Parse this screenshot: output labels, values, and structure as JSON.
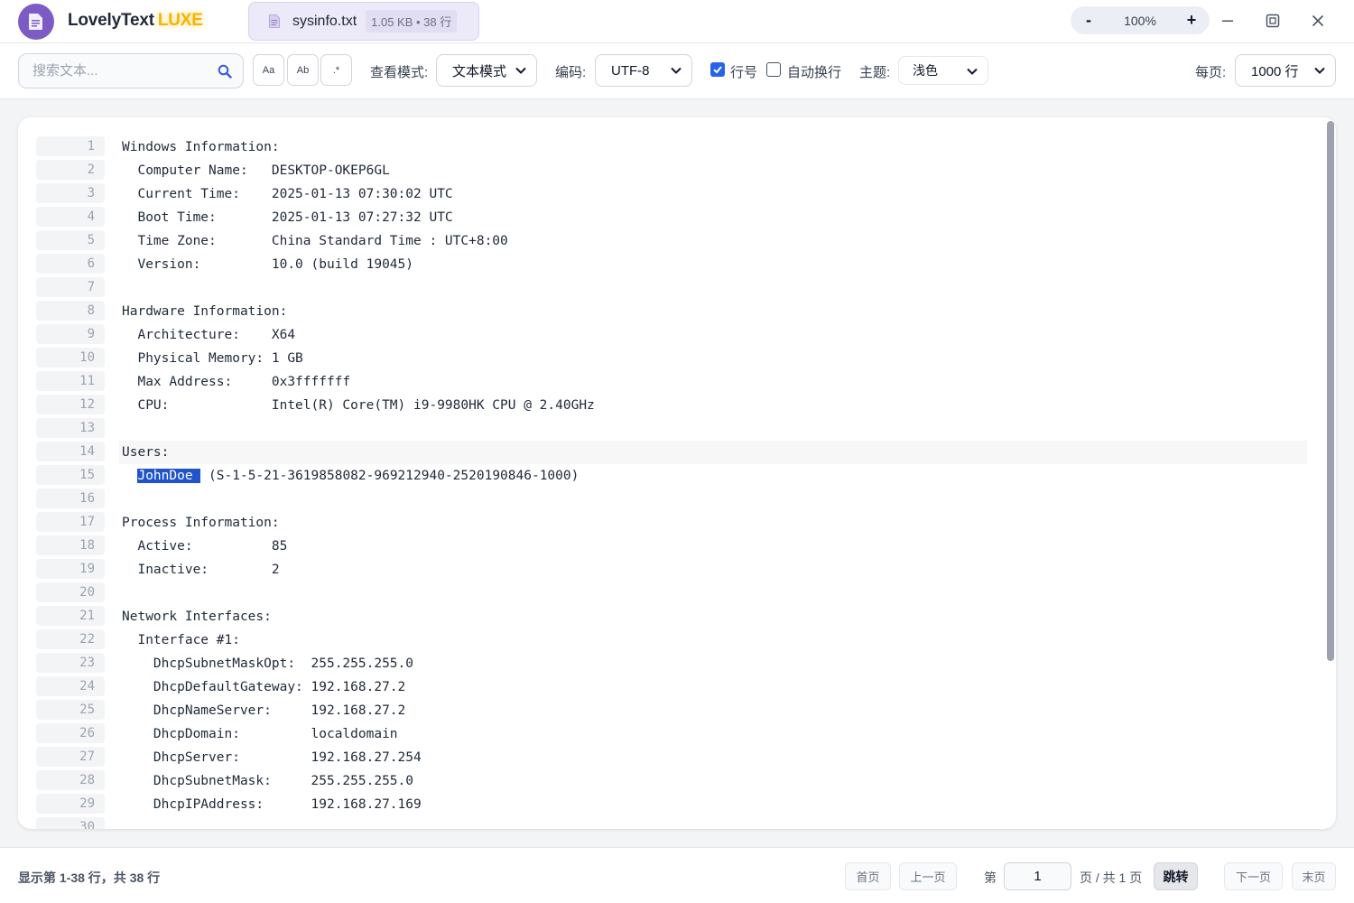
{
  "titlebar": {
    "app_name": "LovelyText",
    "app_badge": "LUXE",
    "file_name": "sysinfo.txt",
    "file_meta": "1.05 KB • 38 行",
    "zoom_out": "-",
    "zoom_level": "100%",
    "zoom_in": "+"
  },
  "toolbar": {
    "search_placeholder": "搜索文本...",
    "match_case": "Aa",
    "whole_word": "Ab",
    "regex": ".*",
    "view_mode_label": "查看模式:",
    "view_mode_value": "文本模式",
    "encoding_label": "编码:",
    "encoding_value": "UTF-8",
    "line_numbers_label": "行号",
    "line_numbers_checked": true,
    "word_wrap_label": "自动换行",
    "word_wrap_checked": false,
    "theme_label": "主题:",
    "theme_value": "浅色",
    "per_page_label": "每页:",
    "per_page_value": "1000 行"
  },
  "document": {
    "lines": [
      "Windows Information:",
      "  Computer Name:   DESKTOP-OKEP6GL",
      "  Current Time:    2025-01-13 07:30:02 UTC",
      "  Boot Time:       2025-01-13 07:27:32 UTC",
      "  Time Zone:       China Standard Time : UTC+8:00",
      "  Version:         10.0 (build 19045)",
      "",
      "Hardware Information:",
      "  Architecture:    X64",
      "  Physical Memory: 1 GB",
      "  Max Address:     0x3fffffff",
      "  CPU:             Intel(R) Core(TM) i9-9980HK CPU @ 2.40GHz",
      "",
      "Users:",
      "  JohnDoe  (S-1-5-21-3619858082-969212940-2520190846-1000)",
      "",
      "Process Information:",
      "  Active:          85",
      "  Inactive:        2",
      "",
      "Network Interfaces:",
      "  Interface #1:",
      "    DhcpSubnetMaskOpt:  255.255.255.0",
      "    DhcpDefaultGateway: 192.168.27.2",
      "    DhcpNameServer:     192.168.27.2",
      "    DhcpDomain:         localdomain",
      "    DhcpServer:         192.168.27.254",
      "    DhcpSubnetMask:     255.255.255.0",
      "    DhcpIPAddress:      192.168.27.169",
      ""
    ],
    "selection_text": "JohnDoe ",
    "selection_line": 15,
    "current_line": 14
  },
  "footer": {
    "status": "显示第 1-38 行，共 38 行",
    "first_page": "首页",
    "prev_page": "上一页",
    "page_prefix": "第",
    "page_value": "1",
    "page_suffix": "页 / 共 1 页",
    "go": "跳转",
    "next_page": "下一页",
    "last_page": "末页"
  },
  "colors": {
    "accent": "#2563eb",
    "logo": "#7c5cc4",
    "luxe": "#f5b400",
    "selection": "#2154c8"
  }
}
